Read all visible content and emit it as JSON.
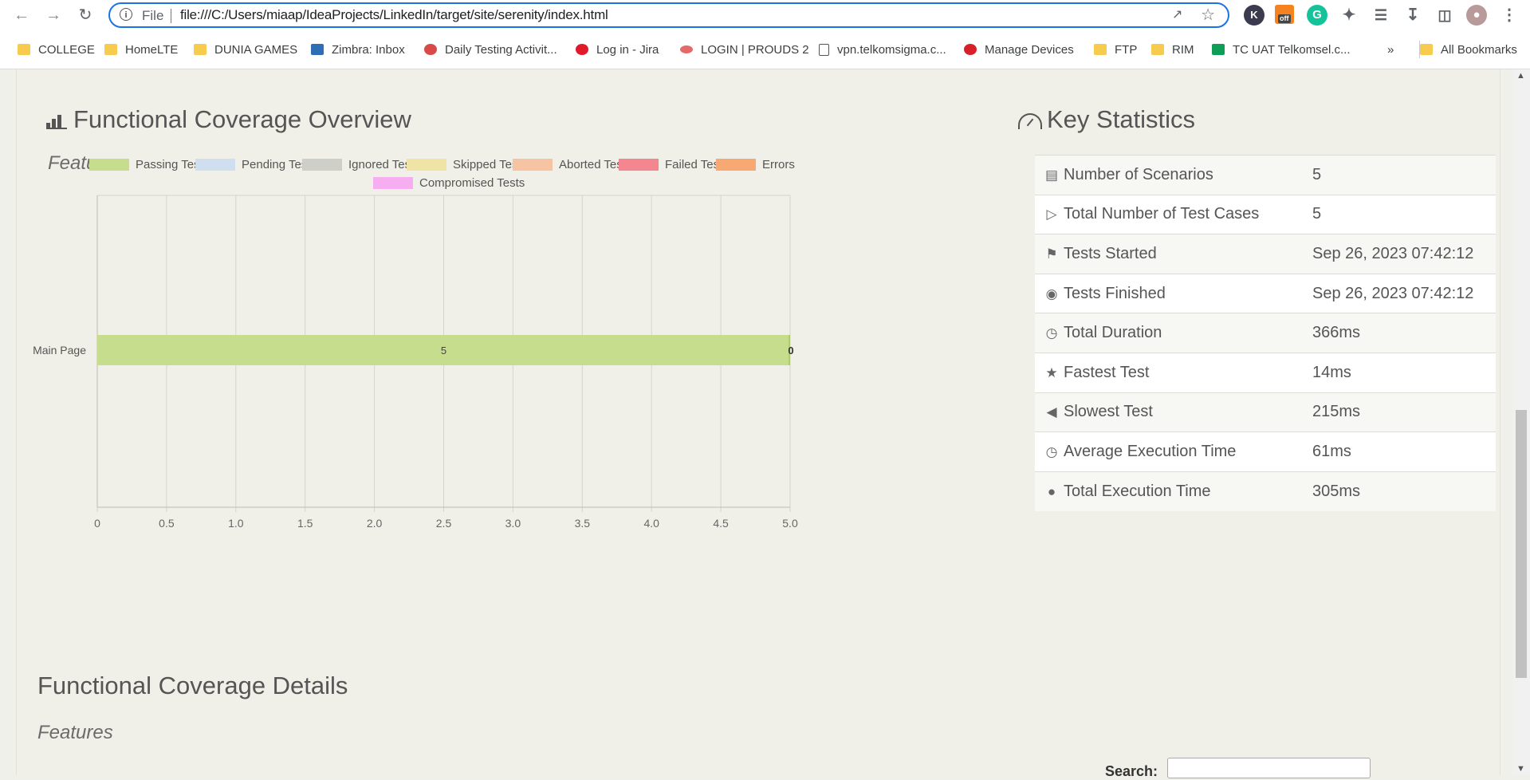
{
  "browser": {
    "scheme_label": "File",
    "url": "file:///C:/Users/miaap/IdeaProjects/LinkedIn/target/site/serenity/index.html",
    "extension_off_badge": "off",
    "bookmarks": [
      {
        "label": "COLLEGE",
        "icon": "folder-icon"
      },
      {
        "label": "HomeLTE",
        "icon": "folder-icon"
      },
      {
        "label": "DUNIA GAMES",
        "icon": "folder-icon"
      },
      {
        "label": "Zimbra: Inbox",
        "icon": "zimbra-icon"
      },
      {
        "label": "Daily Testing Activit...",
        "icon": "testing-icon"
      },
      {
        "label": "Log in - Jira",
        "icon": "jira-icon"
      },
      {
        "label": "LOGIN | PROUDS 2",
        "icon": "prouds-icon"
      },
      {
        "label": "vpn.telkomsigma.c...",
        "icon": "page-icon"
      },
      {
        "label": "Manage Devices",
        "icon": "devices-icon"
      },
      {
        "label": "FTP",
        "icon": "folder-icon"
      },
      {
        "label": "RIM",
        "icon": "folder-icon"
      },
      {
        "label": "TC UAT Telkomsel.c...",
        "icon": "sheets-icon"
      }
    ],
    "more_bookmarks": "»",
    "all_bookmarks": "All Bookmarks"
  },
  "overview": {
    "title": "Functional Coverage Overview",
    "subtitle": "Features"
  },
  "chart_data": {
    "type": "bar",
    "orientation": "horizontal",
    "stacked": true,
    "categories": [
      "Main Page"
    ],
    "series": [
      {
        "name": "Passing Tests",
        "values": [
          5
        ],
        "color": "#c5dd8c"
      },
      {
        "name": "Pending Tests",
        "values": [
          0
        ],
        "color": "#cfdfef"
      },
      {
        "name": "Ignored Tests",
        "values": [
          0
        ],
        "color": "#cfcfca"
      },
      {
        "name": "Skipped Tests",
        "values": [
          0
        ],
        "color": "#efe3a6"
      },
      {
        "name": "Aborted Tests",
        "values": [
          0
        ],
        "color": "#f7c4a3"
      },
      {
        "name": "Failed Tests",
        "values": [
          0
        ],
        "color": "#f3868f"
      },
      {
        "name": "Errors",
        "values": [
          0
        ],
        "color": "#f7a873"
      },
      {
        "name": "Compromised Tests",
        "values": [
          0
        ],
        "color": "#f6aef0"
      }
    ],
    "bar_labels": [
      "5",
      "0"
    ],
    "xlim": [
      0,
      5.0
    ],
    "xticks": [
      "0",
      "0.5",
      "1.0",
      "1.5",
      "2.0",
      "2.5",
      "3.0",
      "3.5",
      "4.0",
      "4.5",
      "5.0"
    ],
    "grid": true,
    "legend": "top"
  },
  "stats": {
    "title": "Key Statistics",
    "rows": [
      {
        "label": "Number of Scenarios",
        "value": "5",
        "icon": "list-icon"
      },
      {
        "label": "Total Number of Test Cases",
        "value": "5",
        "icon": "play-outline-icon"
      },
      {
        "label": "Tests Started",
        "value": "Sep 26, 2023 07:42:12",
        "icon": "flag-icon"
      },
      {
        "label": "Tests Finished",
        "value": "Sep 26, 2023 07:42:12",
        "icon": "stop-circle-icon"
      },
      {
        "label": "Total Duration",
        "value": "366ms",
        "icon": "stopwatch-icon"
      },
      {
        "label": "Fastest Test",
        "value": "14ms",
        "icon": "trophy-icon"
      },
      {
        "label": "Slowest Test",
        "value": "215ms",
        "icon": "step-backward-icon"
      },
      {
        "label": "Average Execution Time",
        "value": "61ms",
        "icon": "stopwatch-icon"
      },
      {
        "label": "Total Execution Time",
        "value": "305ms",
        "icon": "stopwatch-solid-icon"
      }
    ]
  },
  "details": {
    "title": "Functional Coverage Details",
    "subtitle": "Features",
    "search_label": "Search:"
  }
}
